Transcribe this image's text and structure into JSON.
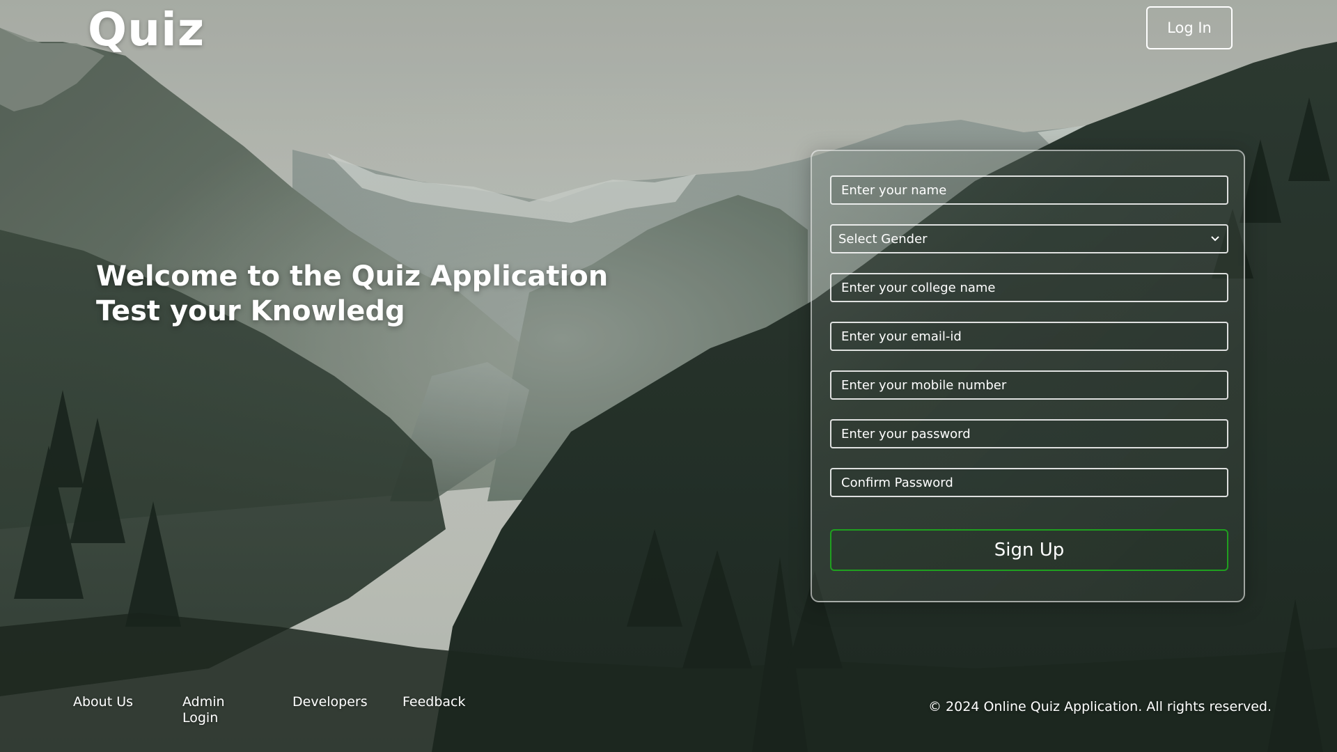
{
  "header": {
    "logo": "Quiz",
    "login_label": "Log In"
  },
  "hero": {
    "line1": "Welcome to the Quiz Application",
    "line2": "Test your Knowledg"
  },
  "form": {
    "name_placeholder": "Enter your name",
    "gender_selected": "Select Gender",
    "college_placeholder": "Enter your college name",
    "email_placeholder": "Enter your email-id",
    "mobile_placeholder": "Enter your mobile number",
    "password_placeholder": "Enter your password",
    "confirm_placeholder": "Confirm Password",
    "submit_label": "Sign Up"
  },
  "footer": {
    "links": [
      "About Us",
      "Admin Login",
      "Developers",
      "Feedback"
    ],
    "copyright": "© 2024 Online Quiz Application. All rights reserved."
  },
  "colors": {
    "text": "#ffffff",
    "signup_border": "#1fa01f",
    "field_border": "#ffffff"
  }
}
